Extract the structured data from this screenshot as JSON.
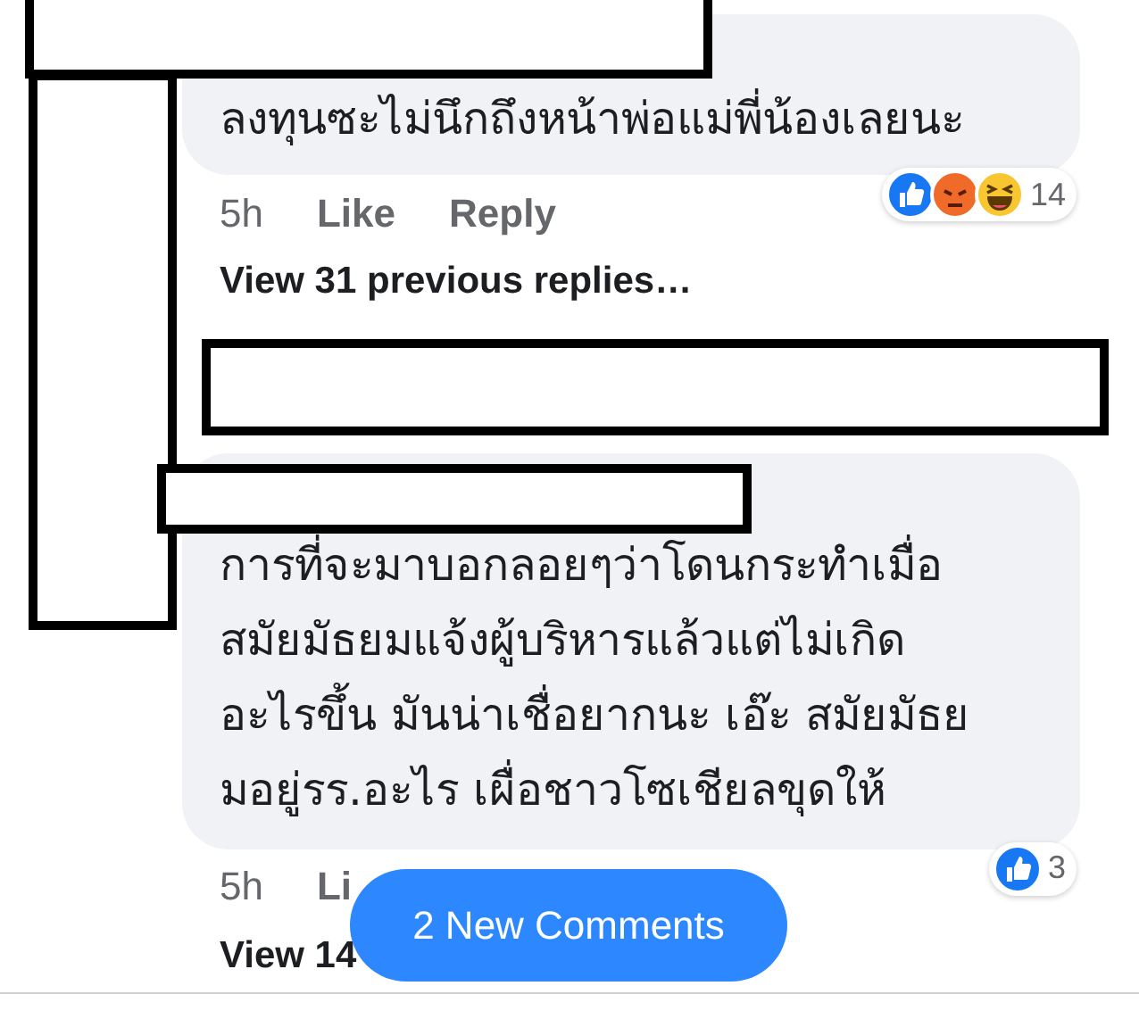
{
  "comments": [
    {
      "lines": [
        "ลงทุนซะไม่นึกถึงหน้าพ่อแม่พี่น้องเลยนะ"
      ],
      "time": "5h",
      "actions": [
        "Like",
        "Reply"
      ],
      "reactions": [
        {
          "kind": "like"
        },
        {
          "kind": "angry"
        },
        {
          "kind": "haha"
        }
      ],
      "reaction_count": "14",
      "more_replies": "View 31 previous replies…"
    },
    {
      "lines": [
        "การที่จะมาบอกลอยๆว่าโดนกระทำเมื่อ",
        "สมัยมัธยมแจ้งผู้บริหารแล้วแต่ไม่เกิด",
        "อะไรขึ้น มันน่าเชื่อยากนะ เอ๊ะ สมัยมัธย",
        "มอยู่รร.อะไร เผื่อชาวโซเชียลขุดให้"
      ],
      "time": "5h",
      "actions": [
        "Li"
      ],
      "reactions": [
        {
          "kind": "like"
        }
      ],
      "reaction_count": "3",
      "more_replies": "View 14"
    }
  ],
  "new_comments_button": "2 New Comments"
}
